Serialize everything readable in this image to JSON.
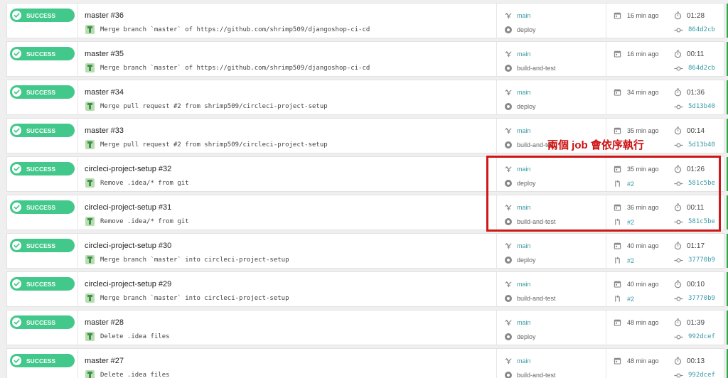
{
  "colors": {
    "success": "#42c88a",
    "link": "#3a9aa6",
    "annotation": "#cc1010"
  },
  "icons": {
    "status": "check-circle-icon",
    "branch": "branch-icon",
    "workflow": "workflow-icon",
    "time": "calendar-icon",
    "duration": "stopwatch-icon",
    "pr": "pull-request-icon",
    "commit": "commit-icon"
  },
  "builds": [
    {
      "status": "SUCCESS",
      "title": "master #36",
      "commit": "Merge branch `master` of https://github.com/shrimp509/djangoshop-ci-cd",
      "branch": "main",
      "workflow": "deploy",
      "time": "16 min ago",
      "duration": "01:28",
      "pr": "",
      "sha": "864d2cb"
    },
    {
      "status": "SUCCESS",
      "title": "master #35",
      "commit": "Merge branch `master` of https://github.com/shrimp509/djangoshop-ci-cd",
      "branch": "main",
      "workflow": "build-and-test",
      "time": "16 min ago",
      "duration": "00:11",
      "pr": "",
      "sha": "864d2cb"
    },
    {
      "status": "SUCCESS",
      "title": "master #34",
      "commit": "Merge pull request #2 from shrimp509/circleci-project-setup",
      "branch": "main",
      "workflow": "deploy",
      "time": "34 min ago",
      "duration": "01:36",
      "pr": "",
      "sha": "5d13b40"
    },
    {
      "status": "SUCCESS",
      "title": "master #33",
      "commit": "Merge pull request #2 from shrimp509/circleci-project-setup",
      "branch": "main",
      "workflow": "build-and-test",
      "time": "35 min ago",
      "duration": "00:14",
      "pr": "",
      "sha": "5d13b40"
    },
    {
      "status": "SUCCESS",
      "title": "circleci-project-setup #32",
      "commit": "Remove .idea/* from git",
      "branch": "main",
      "workflow": "deploy",
      "time": "35 min ago",
      "duration": "01:26",
      "pr": "#2",
      "sha": "581c5be"
    },
    {
      "status": "SUCCESS",
      "title": "circleci-project-setup #31",
      "commit": "Remove .idea/* from git",
      "branch": "main",
      "workflow": "build-and-test",
      "time": "36 min ago",
      "duration": "00:11",
      "pr": "#2",
      "sha": "581c5be"
    },
    {
      "status": "SUCCESS",
      "title": "circleci-project-setup #30",
      "commit": "Merge branch `master` into circleci-project-setup",
      "branch": "main",
      "workflow": "deploy",
      "time": "40 min ago",
      "duration": "01:17",
      "pr": "#2",
      "sha": "37770b9"
    },
    {
      "status": "SUCCESS",
      "title": "circleci-project-setup #29",
      "commit": "Merge branch `master` into circleci-project-setup",
      "branch": "main",
      "workflow": "build-and-test",
      "time": "40 min ago",
      "duration": "00:10",
      "pr": "#2",
      "sha": "37770b9"
    },
    {
      "status": "SUCCESS",
      "title": "master #28",
      "commit": "Delete .idea files",
      "branch": "main",
      "workflow": "deploy",
      "time": "48 min ago",
      "duration": "01:39",
      "pr": "",
      "sha": "992dcef"
    },
    {
      "status": "SUCCESS",
      "title": "master #27",
      "commit": "Delete .idea files",
      "branch": "main",
      "workflow": "build-and-test",
      "time": "48 min ago",
      "duration": "00:13",
      "pr": "",
      "sha": "992dcef"
    }
  ],
  "annotation": {
    "text": "兩個 job 會依序執行"
  }
}
